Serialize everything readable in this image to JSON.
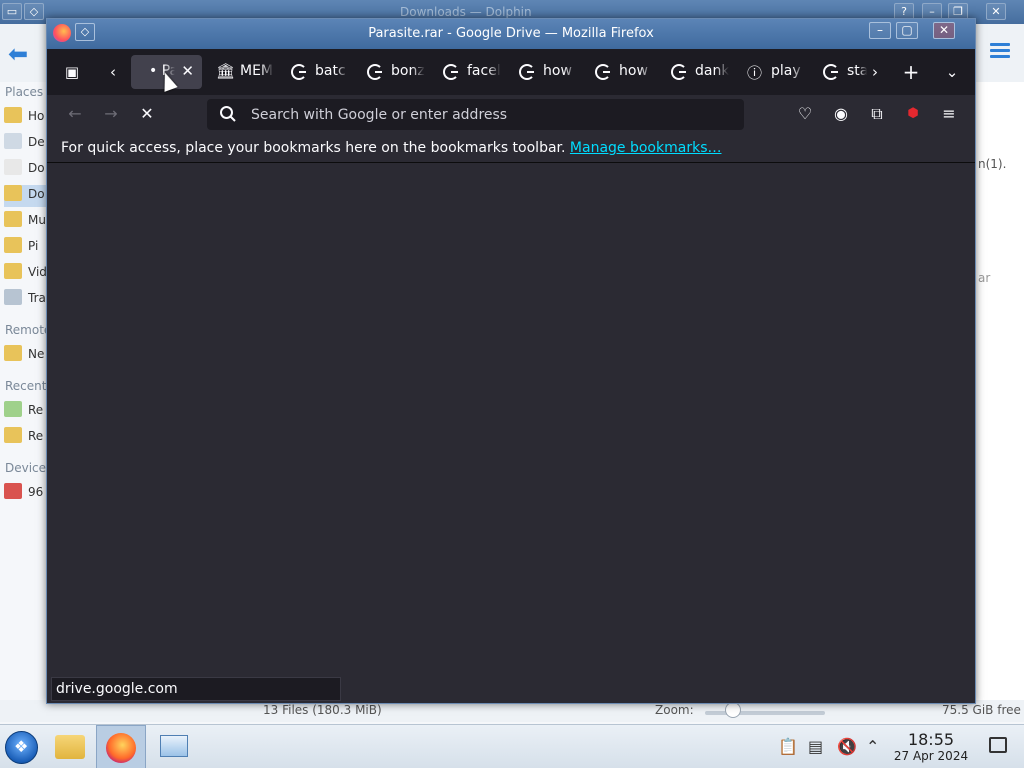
{
  "dolphin": {
    "title": "Downloads — Dolphin",
    "places_heading": "Places",
    "places": [
      "Ho",
      "De",
      "Do",
      "Do",
      "Mu",
      "Pi",
      "Vid",
      "Tra"
    ],
    "remote_heading": "Remote",
    "remote": [
      "Ne"
    ],
    "recent_heading": "Recent",
    "recent": [
      "Re",
      "Re"
    ],
    "devices_heading": "Devices",
    "devices": [
      "96"
    ],
    "right_text_1": "n(1).",
    "right_text_2": "ar",
    "status_files": "13 Files (180.3 MiB)",
    "zoom_label": "Zoom:",
    "free_space": "75.5 GiB free"
  },
  "firefox": {
    "window_title": "Parasite.rar - Google Drive — Mozilla Firefox",
    "tabs": [
      {
        "label": "• Pa",
        "icon": "loading-dot",
        "active": true
      },
      {
        "label": "MEM",
        "icon": "museum-icon"
      },
      {
        "label": "batc",
        "icon": "google-icon"
      },
      {
        "label": "bonz",
        "icon": "google-icon"
      },
      {
        "label": "facel",
        "icon": "google-icon"
      },
      {
        "label": "how",
        "icon": "google-icon"
      },
      {
        "label": "how",
        "icon": "google-icon"
      },
      {
        "label": "dank",
        "icon": "google-icon"
      },
      {
        "label": "play",
        "icon": "info-icon"
      },
      {
        "label": "sta",
        "icon": "google-icon"
      }
    ],
    "url_placeholder": "Search with Google or enter address",
    "bookmarks_message": "For quick access, place your bookmarks here on the bookmarks toolbar.",
    "manage_bookmarks": "Manage bookmarks…",
    "status_url": "drive.google.com"
  },
  "taskbar": {
    "time": "18:55",
    "date": "27 Apr 2024"
  }
}
